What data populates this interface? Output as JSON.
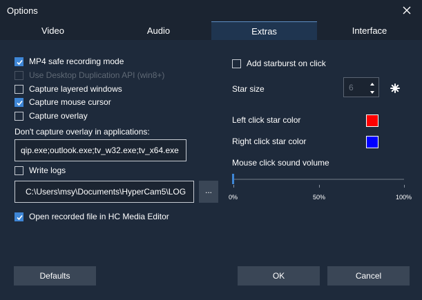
{
  "window": {
    "title": "Options"
  },
  "tabs": [
    {
      "label": "Video"
    },
    {
      "label": "Audio"
    },
    {
      "label": "Extras"
    },
    {
      "label": "Interface"
    }
  ],
  "left": {
    "mp4_safe": {
      "label": "MP4 safe recording mode",
      "checked": true
    },
    "desktop_dup": {
      "label": "Use Desktop Duplication API (win8+)",
      "checked": false,
      "disabled": true
    },
    "layered": {
      "label": "Capture layered windows",
      "checked": false
    },
    "mouse_cursor": {
      "label": "Capture mouse cursor",
      "checked": true
    },
    "overlay": {
      "label": "Capture overlay",
      "checked": false
    },
    "overlay_apps_label": "Don't capture overlay in applications:",
    "overlay_apps_value": "qip.exe;outlook.exe;tv_w32.exe;tv_x64.exe",
    "write_logs": {
      "label": "Write logs",
      "checked": false
    },
    "log_path_value": "C:\\Users\\msy\\Documents\\HyperCam5\\LOG",
    "browse_label": "...",
    "open_editor": {
      "label": "Open recorded file in HC Media Editor",
      "checked": true
    }
  },
  "right": {
    "starburst": {
      "label": "Add starburst on click",
      "checked": false
    },
    "star_size_label": "Star size",
    "star_size_value": "6",
    "left_color_label": "Left click star color",
    "left_color": "#ff0000",
    "right_color_label": "Right click star color",
    "right_color": "#0000ff",
    "volume_label": "Mouse click sound volume",
    "volume_value": 0,
    "ticks": [
      "0%",
      "50%",
      "100%"
    ]
  },
  "buttons": {
    "defaults": "Defaults",
    "ok": "OK",
    "cancel": "Cancel"
  },
  "colors": {
    "accent": "#3e86d6",
    "background": "#1e2a3b"
  },
  "icons": [
    "close-icon",
    "check-icon",
    "spin-up-icon",
    "spin-down-icon",
    "starburst-icon"
  ]
}
